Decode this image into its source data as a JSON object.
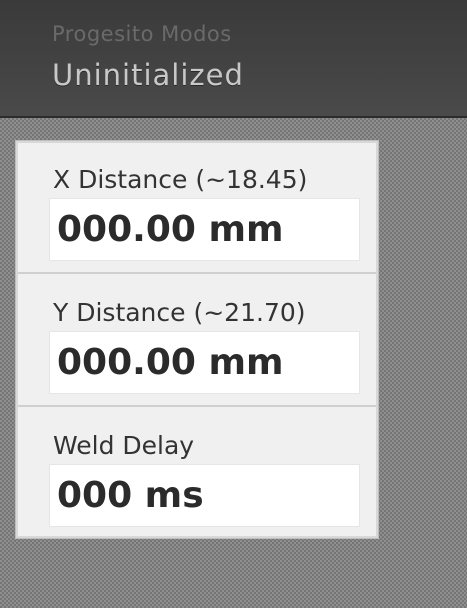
{
  "header": {
    "subtitle": "Progesito Modos",
    "title": "Uninitialized"
  },
  "fields": [
    {
      "label": "X Distance (~18.45)",
      "value": "000.00 mm"
    },
    {
      "label": "Y Distance (~21.70)",
      "value": "000.00 mm"
    },
    {
      "label": "Weld Delay",
      "value": "000 ms"
    }
  ]
}
